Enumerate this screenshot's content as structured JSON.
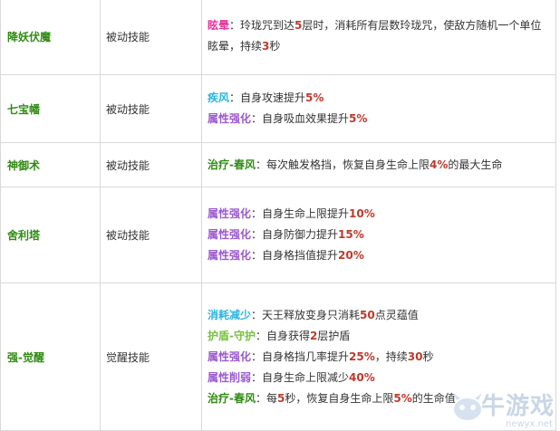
{
  "colors": {
    "name": "#2e8b10",
    "pink": "#e8359b",
    "cyan": "#2bb5e0",
    "purple": "#9b59d0",
    "green": "#2e8b10",
    "number": "#c0392b"
  },
  "rows": [
    {
      "name": "降妖伏魔",
      "type": "被动技能",
      "lines": [
        {
          "kw": "眩晕",
          "color": "#e8359b",
          "parts": [
            "：玲珑咒到达",
            "5",
            "层时，消耗所有层数玲珑咒，使敌方随机一个单位"
          ]
        },
        {
          "kw": "",
          "color": "",
          "parts": [
            "眩晕，持续",
            "3",
            "秒"
          ]
        }
      ]
    },
    {
      "name": "七宝幡",
      "type": "被动技能",
      "lines": [
        {
          "kw": "疾风",
          "color": "#2bb5e0",
          "parts": [
            "：自身攻速提升",
            "5%",
            ""
          ]
        },
        {
          "kw": "属性强化",
          "color": "#9b59d0",
          "parts": [
            "：自身吸血效果提升",
            "5%",
            ""
          ]
        }
      ]
    },
    {
      "name": "神御术",
      "type": "被动技能",
      "lines": [
        {
          "kw": "治疗-春风",
          "color": "#2e8b10",
          "parts": [
            "：每次触发格挡，恢复自身生命上限",
            "4%",
            "的最大生命"
          ]
        }
      ]
    },
    {
      "name": "舍利塔",
      "type": "被动技能",
      "lines": [
        {
          "kw": "属性强化",
          "color": "#9b59d0",
          "parts": [
            "：自身生命上限提升",
            "10%",
            ""
          ]
        },
        {
          "kw": "属性强化",
          "color": "#9b59d0",
          "parts": [
            "：自身防御力提升",
            "15%",
            ""
          ]
        },
        {
          "kw": "属性强化",
          "color": "#9b59d0",
          "parts": [
            "：自身格挡值提升",
            "20%",
            ""
          ]
        }
      ]
    },
    {
      "name": "强-觉醒",
      "type": "觉醒技能",
      "lines": [
        {
          "kw": "消耗减少",
          "color": "#2bb5e0",
          "parts": [
            "：天王释放变身只消耗",
            "50",
            "点灵蕴值"
          ]
        },
        {
          "kw": "护盾-守护",
          "color": "#7bc043",
          "parts": [
            "：自身获得",
            "2",
            "层护盾"
          ]
        },
        {
          "kw": "属性强化",
          "color": "#9b59d0",
          "parts": [
            "：自身格挡几率提升",
            "25%",
            "，持续",
            "30",
            "秒"
          ]
        },
        {
          "kw": "属性削弱",
          "color": "#9b59d0",
          "parts": [
            "：自身生命上限减少",
            "40%",
            ""
          ]
        },
        {
          "kw": "治疗-春风",
          "color": "#2e8b10",
          "parts": [
            "：每",
            "5",
            "秒，恢复自身生命上限",
            "5%",
            "的生命值"
          ]
        }
      ]
    }
  ],
  "watermark": {
    "text": "牛游戏",
    "url": "newyx.net"
  }
}
